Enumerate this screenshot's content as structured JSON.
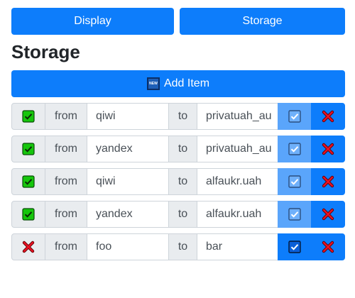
{
  "tabs": {
    "display": "Display",
    "storage": "Storage"
  },
  "page": {
    "title": "Storage"
  },
  "add_button": {
    "label": "Add Item",
    "icon": "new-badge-icon",
    "icon_text": "NEW"
  },
  "row_labels": {
    "from": "from",
    "to": "to"
  },
  "colors": {
    "primary": "#0d7dfb",
    "primary_light": "#5aa5fb",
    "success": "#16c60c",
    "danger": "#e81123"
  },
  "rows": [
    {
      "enabled": true,
      "from": "qiwi",
      "to": "privatuah_au",
      "toggle_active": false
    },
    {
      "enabled": true,
      "from": "yandex",
      "to": "privatuah_au",
      "toggle_active": false
    },
    {
      "enabled": true,
      "from": "qiwi",
      "to": "alfaukr.uah",
      "toggle_active": false
    },
    {
      "enabled": true,
      "from": "yandex",
      "to": "alfaukr.uah",
      "toggle_active": false
    },
    {
      "enabled": false,
      "from": "foo",
      "to": "bar",
      "toggle_active": true
    }
  ]
}
